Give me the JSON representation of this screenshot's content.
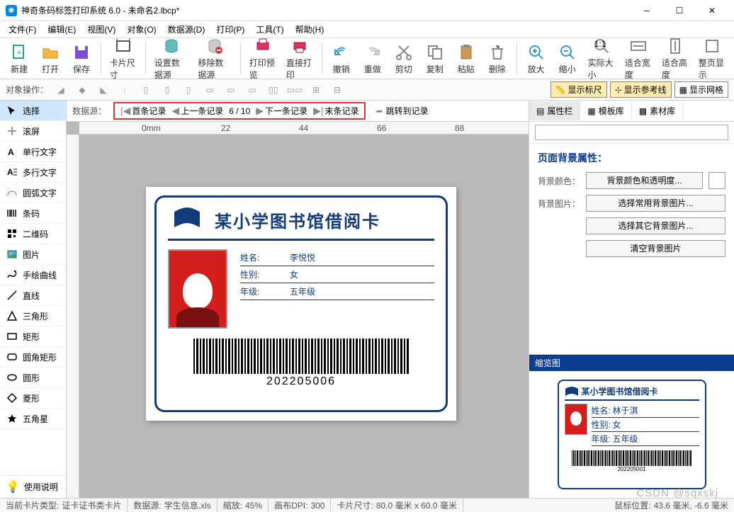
{
  "window": {
    "title": "神奇条码标签打印系统 6.0 - 未命名2.lbcp*"
  },
  "menus": [
    "文件(F)",
    "编辑(E)",
    "视图(V)",
    "对象(O)",
    "数据源(D)",
    "打印(P)",
    "工具(T)",
    "帮助(H)"
  ],
  "toolbar": [
    {
      "id": "new",
      "label": "新建"
    },
    {
      "id": "open",
      "label": "打开"
    },
    {
      "id": "save",
      "label": "保存"
    },
    {
      "id": "sep"
    },
    {
      "id": "cardsize",
      "label": "卡片尺寸"
    },
    {
      "id": "sep"
    },
    {
      "id": "setds",
      "label": "设置数据源"
    },
    {
      "id": "removeds",
      "label": "移除数据源"
    },
    {
      "id": "sep"
    },
    {
      "id": "printpreview",
      "label": "打印预览"
    },
    {
      "id": "directprint",
      "label": "直接打印"
    },
    {
      "id": "sep"
    },
    {
      "id": "undo",
      "label": "撤销"
    },
    {
      "id": "redo",
      "label": "重做"
    },
    {
      "id": "cut",
      "label": "剪切"
    },
    {
      "id": "copy",
      "label": "复制"
    },
    {
      "id": "paste",
      "label": "粘贴"
    },
    {
      "id": "delete",
      "label": "删除"
    },
    {
      "id": "sep"
    },
    {
      "id": "zoomin",
      "label": "放大"
    },
    {
      "id": "zoomout",
      "label": "缩小"
    },
    {
      "id": "actual",
      "label": "实际大小"
    },
    {
      "id": "fitw",
      "label": "适合宽度"
    },
    {
      "id": "fith",
      "label": "适合高度"
    },
    {
      "id": "fitpage",
      "label": "整页显示"
    }
  ],
  "opsbar": {
    "label": "对象操作：",
    "toggles": [
      {
        "id": "show-ruler",
        "label": "显示标尺",
        "on": true
      },
      {
        "id": "show-guides",
        "label": "显示参考线",
        "on": true
      },
      {
        "id": "show-grid",
        "label": "显示网格",
        "on": false
      }
    ]
  },
  "leftTools": [
    {
      "id": "select",
      "label": "选择",
      "sel": true
    },
    {
      "id": "pan",
      "label": "滚屏"
    },
    {
      "id": "text-single",
      "label": "单行文字"
    },
    {
      "id": "text-multi",
      "label": "多行文字"
    },
    {
      "id": "text-arc",
      "label": "圆弧文字"
    },
    {
      "id": "barcode",
      "label": "条码"
    },
    {
      "id": "qrcode",
      "label": "二维码"
    },
    {
      "id": "image",
      "label": "图片"
    },
    {
      "id": "freehand",
      "label": "手绘曲线"
    },
    {
      "id": "line",
      "label": "直线"
    },
    {
      "id": "triangle",
      "label": "三角形"
    },
    {
      "id": "rect",
      "label": "矩形"
    },
    {
      "id": "roundrect",
      "label": "圆角矩形"
    },
    {
      "id": "ellipse",
      "label": "圆形"
    },
    {
      "id": "diamond",
      "label": "菱形"
    },
    {
      "id": "star",
      "label": "五角星"
    }
  ],
  "helpBtn": "使用说明",
  "datasrc": {
    "label": "数据源：",
    "first": "首条记录",
    "prev": "上一条记录",
    "pos": "6 / 10",
    "next": "下一条记录",
    "last": "末条记录",
    "jump": "跳转到记录"
  },
  "ruler": {
    "marks": [
      "0mm",
      "22",
      "44",
      "66",
      "88"
    ]
  },
  "card": {
    "title": "某小学图书馆借阅卡",
    "fields": [
      {
        "k": "姓名:",
        "v": "李悦悦"
      },
      {
        "k": "性别:",
        "v": "女"
      },
      {
        "k": "年级:",
        "v": "五年级"
      }
    ],
    "barcode": "202205006"
  },
  "right": {
    "tabs": [
      {
        "id": "props",
        "label": "属性栏",
        "act": true
      },
      {
        "id": "templates",
        "label": "模板库"
      },
      {
        "id": "assets",
        "label": "素材库"
      }
    ],
    "sectionTitle": "页面背景属性：",
    "bgColorLabel": "背景颜色：",
    "bgColorBtn": "背景颜色和透明度...",
    "bgImgLabel": "背景图片：",
    "bgImgBtn1": "选择常用背景图片...",
    "bgImgBtn2": "选择其它背景图片...",
    "bgImgBtn3": "清空背景图片",
    "previewTitle": "缩览图",
    "mini": {
      "title": "某小学图书馆借阅卡",
      "fields": [
        {
          "k": "姓名:",
          "v": "林于淇"
        },
        {
          "k": "性别:",
          "v": "女"
        },
        {
          "k": "年级:",
          "v": "五年级"
        }
      ],
      "barcode": "202205001"
    }
  },
  "status": {
    "cardType": {
      "k": "当前卡片类型:",
      "v": "证卡证书类卡片"
    },
    "ds": {
      "k": "数据源:",
      "v": "学生信息.xls"
    },
    "zoom": {
      "k": "缩放:",
      "v": "45%"
    },
    "dpi": {
      "k": "画布DPI:",
      "v": "300"
    },
    "size": {
      "k": "卡片尺寸:",
      "v": "80.0 毫米 x 60.0 毫米"
    },
    "mouse": {
      "k": "鼠标位置:",
      "v": "43.6 毫米, -6.6 毫米"
    }
  },
  "watermark": "CSDN @sqxskj"
}
